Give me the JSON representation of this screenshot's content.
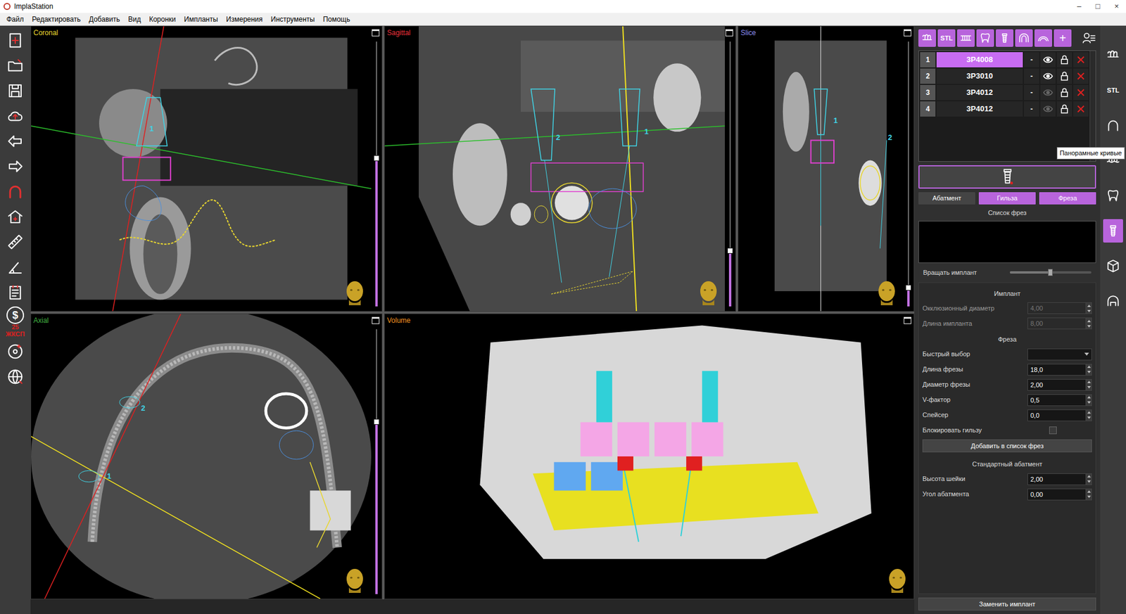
{
  "window": {
    "title": "ImplaStation",
    "controls": [
      "–",
      "□",
      "×"
    ]
  },
  "menu": [
    "Файл",
    "Редактировать",
    "Добавить",
    "Вид",
    "Коронки",
    "Импланты",
    "Измерения",
    "Инструменты",
    "Помощь"
  ],
  "left_toolbar": {
    "price_symbol": "$",
    "count": "25",
    "unit": "ЖКСП"
  },
  "views": [
    {
      "title": "Coronal",
      "color": "#e8d630",
      "slider": 0.56,
      "markers": [
        "1"
      ]
    },
    {
      "title": "Sagittal",
      "color": "#e8303a",
      "slider": 0.21,
      "markers": [
        "2",
        "1"
      ]
    },
    {
      "title": "Slice",
      "color": "#8a8cf0",
      "slider": 0.07,
      "markers": [
        "1",
        "2"
      ]
    },
    {
      "title": "Axial",
      "color": "#40b040",
      "slider": 0.65,
      "markers": [
        "2",
        "1"
      ]
    },
    {
      "title": "Volume",
      "color": "#f09020",
      "markers": []
    }
  ],
  "right_toolbar": [
    {
      "kind": "icon"
    },
    {
      "kind": "text",
      "label": "STL"
    },
    {
      "kind": "icon"
    },
    {
      "kind": "icon"
    },
    {
      "kind": "icon"
    },
    {
      "kind": "icon"
    },
    {
      "kind": "icon"
    },
    {
      "kind": "text",
      "label": "+"
    }
  ],
  "implants": {
    "rows": [
      {
        "number": "1",
        "name": "3P4008",
        "dash": "-",
        "visible": true,
        "selected": true
      },
      {
        "number": "2",
        "name": "3P3010",
        "dash": "-",
        "visible": true,
        "selected": false
      },
      {
        "number": "3",
        "name": "3P4012",
        "dash": "-",
        "visible": false,
        "selected": false
      },
      {
        "number": "4",
        "name": "3P4012",
        "dash": "-",
        "visible": false,
        "selected": false
      }
    ]
  },
  "tabs": [
    {
      "label": "Абатмент",
      "selected": false
    },
    {
      "label": "Гильза",
      "selected": true
    },
    {
      "label": "Фреза",
      "selected": true
    }
  ],
  "drill_list": {
    "title": "Список фрез"
  },
  "rotate": {
    "label": "Вращать имплант",
    "level": 0.5
  },
  "implant_section": {
    "title": "Имплант",
    "fields": [
      {
        "kind": "spin",
        "label": "Окклюзионный диаметр",
        "value": "4,00",
        "disabled": true
      },
      {
        "kind": "spin",
        "label": "Длина импланта",
        "value": "8,00",
        "disabled": true
      }
    ]
  },
  "drill_section": {
    "title": "Фреза",
    "fields": [
      {
        "kind": "select",
        "label": "Быстрый выбор",
        "value": ""
      },
      {
        "kind": "spin",
        "label": "Длина фрезы",
        "value": "18,0",
        "disabled": false
      },
      {
        "kind": "spin",
        "label": "Диаметр фрезы",
        "value": "2,00",
        "disabled": false
      },
      {
        "kind": "spin",
        "label": "V-фактор",
        "value": "0,5",
        "disabled": false
      },
      {
        "kind": "spin",
        "label": "Спейсер",
        "value": "0,0",
        "disabled": false
      },
      {
        "kind": "checkbox",
        "label": "Блокировать гильзу",
        "checked": false
      }
    ],
    "button": "Добавить в список фрез"
  },
  "abutment_section": {
    "title": "Стандартный абатмент",
    "fields": [
      {
        "kind": "spin",
        "label": "Высота шейки",
        "value": "2,00",
        "disabled": false
      },
      {
        "kind": "spin",
        "label": "Угол абатмента",
        "value": "0,00",
        "disabled": false
      }
    ]
  },
  "replace_button": "Заменить имплант",
  "far_right": [
    {
      "kind": "icon",
      "selected": false
    },
    {
      "kind": "text",
      "label": "STL",
      "selected": false
    },
    {
      "kind": "icon",
      "selected": false
    },
    {
      "kind": "icon",
      "selected": false
    },
    {
      "kind": "icon",
      "selected": false
    },
    {
      "kind": "icon",
      "selected": true
    },
    {
      "kind": "icon",
      "selected": false
    },
    {
      "kind": "icon",
      "selected": false
    }
  ],
  "tooltip": "Панорамные кривые"
}
